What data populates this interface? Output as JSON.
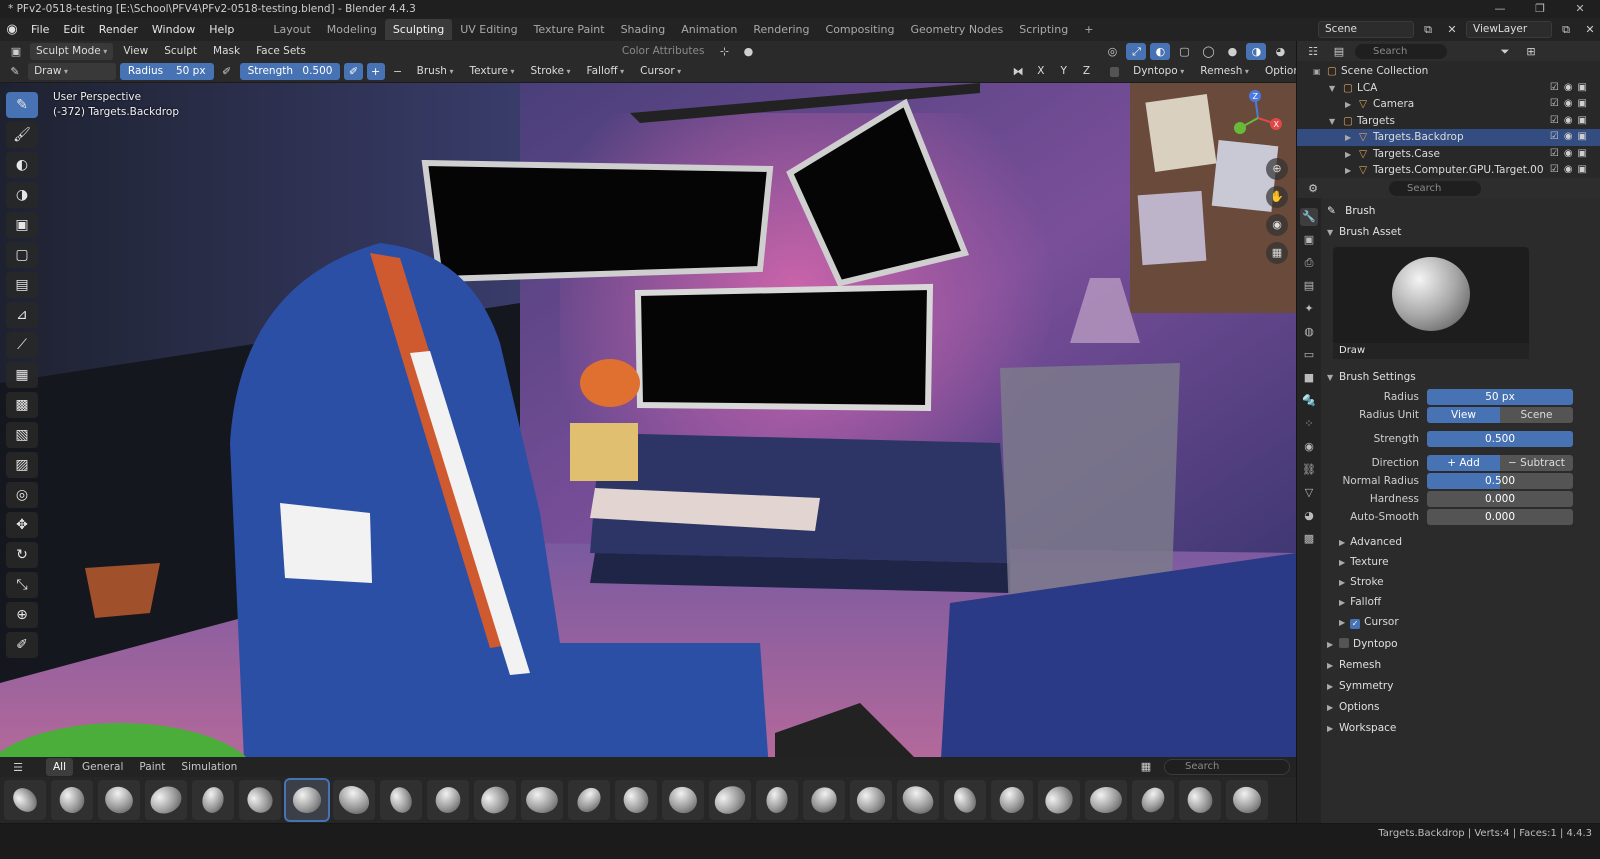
{
  "titlebar": {
    "title": "* PFv2-0518-testing [E:\\School\\PFV4\\PFv2-0518-testing.blend] - Blender 4.4.3"
  },
  "menu": {
    "items": [
      "File",
      "Edit",
      "Render",
      "Window",
      "Help"
    ]
  },
  "workspaces": [
    "Layout",
    "Modeling",
    "Sculpting",
    "UV Editing",
    "Texture Paint",
    "Shading",
    "Animation",
    "Rendering",
    "Compositing",
    "Geometry Nodes",
    "Scripting"
  ],
  "active_workspace": "Sculpting",
  "scene": {
    "name": "Scene",
    "view_layer": "ViewLayer"
  },
  "header1": {
    "mode": "Sculpt Mode",
    "menus": [
      "View",
      "Sculpt",
      "Mask",
      "Face Sets"
    ],
    "color_attributes": "Color Attributes"
  },
  "header2": {
    "brush": "Draw",
    "radius_label": "Radius",
    "radius_value": "50 px",
    "strength_label": "Strength",
    "strength_value": "0.500",
    "menus": [
      "Brush",
      "Texture",
      "Stroke",
      "Falloff",
      "Cursor"
    ],
    "axes": [
      "X",
      "Y",
      "Z"
    ],
    "right_menus": [
      "Dyntopo",
      "Remesh",
      "Options"
    ]
  },
  "viewport": {
    "perspective": "User Perspective",
    "object_info": "(-372) Targets.Backdrop"
  },
  "asset_shelf": {
    "tabs": [
      "All",
      "General",
      "Paint",
      "Simulation"
    ],
    "active_tab": "All",
    "search_placeholder": "Search",
    "brush_count": 27,
    "active_index": 6
  },
  "statusbar": {
    "text": "Targets.Backdrop | Verts:4 | Faces:1 | 4.4.3"
  },
  "outliner": {
    "search_placeholder": "Search",
    "rows": [
      {
        "label": "Scene Collection",
        "indent": 0
      },
      {
        "label": "LCA",
        "indent": 1
      },
      {
        "label": "Camera",
        "indent": 2
      },
      {
        "label": "Targets",
        "indent": 1
      },
      {
        "label": "Targets.Backdrop",
        "indent": 2,
        "selected": true
      },
      {
        "label": "Targets.Case",
        "indent": 2
      },
      {
        "label": "Targets.Computer.GPU.Target.00",
        "indent": 2
      }
    ]
  },
  "properties": {
    "search_placeholder": "Search",
    "title": "Brush",
    "brush_asset_header": "Brush Asset",
    "brush_asset_name": "Draw",
    "brush_settings_header": "Brush Settings",
    "radius_label": "Radius",
    "radius_value": "50 px",
    "radius_unit_label": "Radius Unit",
    "radius_unit_options": [
      "View",
      "Scene"
    ],
    "radius_unit_active": "View",
    "strength_label": "Strength",
    "strength_value": "0.500",
    "direction_label": "Direction",
    "direction_options": [
      "+ Add",
      "− Subtract"
    ],
    "direction_active": "+ Add",
    "normal_radius_label": "Normal Radius",
    "normal_radius_value": "0.500",
    "hardness_label": "Hardness",
    "hardness_value": "0.000",
    "auto_smooth_label": "Auto-Smooth",
    "auto_smooth_value": "0.000",
    "subpanels": [
      "Advanced",
      "Texture",
      "Stroke",
      "Falloff",
      "Cursor"
    ],
    "panels": [
      "Dyntopo",
      "Remesh",
      "Symmetry",
      "Options",
      "Workspace"
    ],
    "normal_radius_fraction": 0.5,
    "strength_fraction": 0.5
  },
  "colors": {
    "accent": "#4772b3",
    "selected_row": "#334d80"
  }
}
